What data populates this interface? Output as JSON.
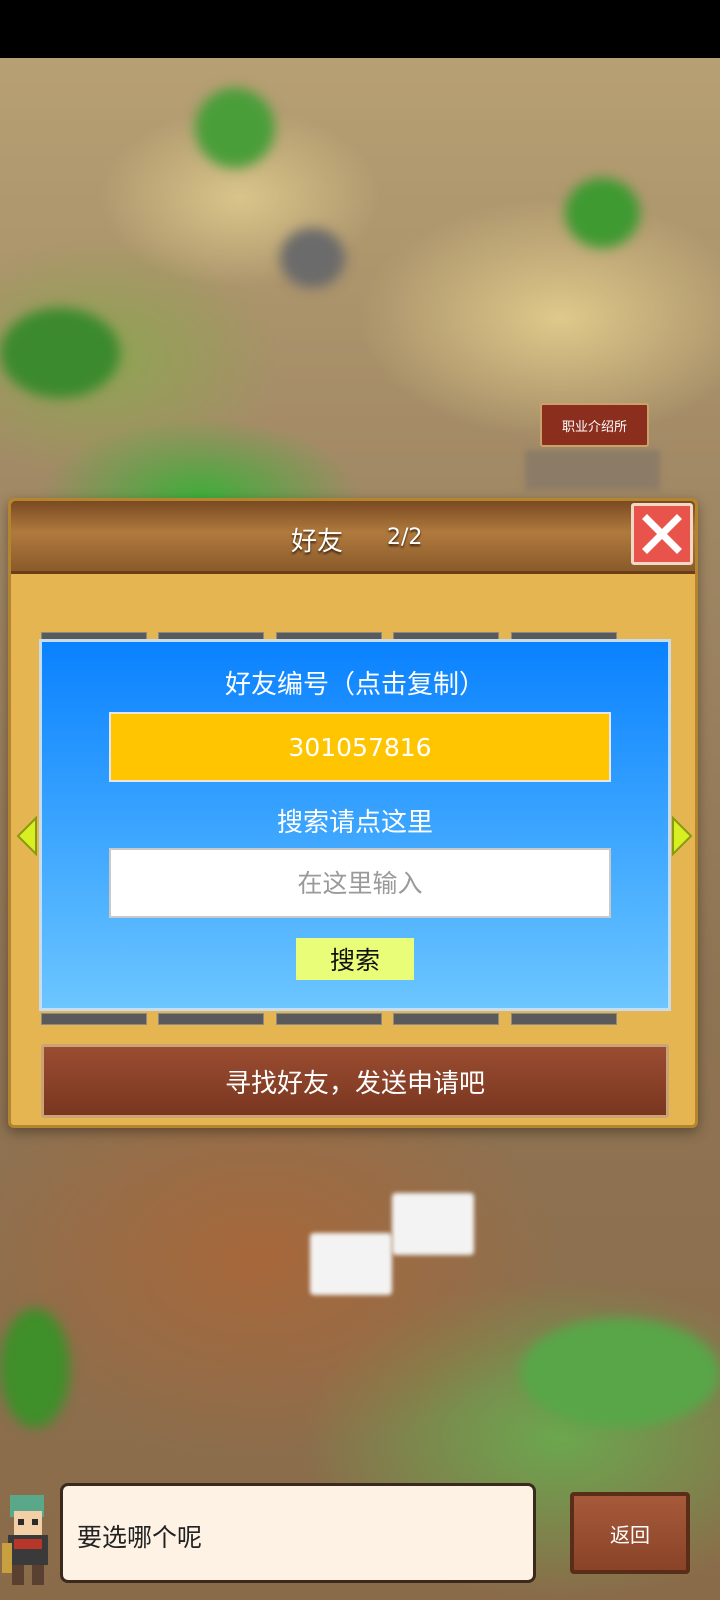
{
  "background": {
    "job_sign": "职业介绍所"
  },
  "dialog": {
    "title": "好友",
    "count": "2/2",
    "close_icon": "close-icon",
    "friend_id_label": "好友编号（点击复制）",
    "friend_id": "301057816",
    "search_label": "搜索请点这里",
    "search_placeholder": "在这里输入",
    "search_button": "搜索",
    "find_friends_button": "寻找好友，发送申请吧"
  },
  "bottom_bar": {
    "speech": "要选哪个呢",
    "back_button": "返回"
  },
  "colors": {
    "dialog_bg": "#e5b552",
    "panel_blue": "#0a82ff",
    "id_box": "#ffc500",
    "search_button": "#eafd78",
    "close_red": "#e8534b"
  }
}
